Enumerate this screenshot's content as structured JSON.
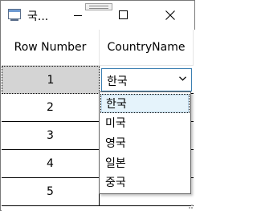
{
  "window": {
    "title": "국..."
  },
  "grid": {
    "columns": [
      "Row Number",
      "CountryName"
    ],
    "rows": [
      {
        "number": "1",
        "country": "한국"
      },
      {
        "number": "2",
        "country": ""
      },
      {
        "number": "3",
        "country": ""
      },
      {
        "number": "4",
        "country": ""
      },
      {
        "number": "5",
        "country": ""
      }
    ]
  },
  "dropdown": {
    "options": [
      "한국",
      "미국",
      "영국",
      "일본",
      "중국"
    ],
    "selected": "한국"
  },
  "colors": {
    "selected_row": "#d4d4d4",
    "combo_border": "#3c7fb1",
    "option_highlight": "#e5f3fb"
  }
}
